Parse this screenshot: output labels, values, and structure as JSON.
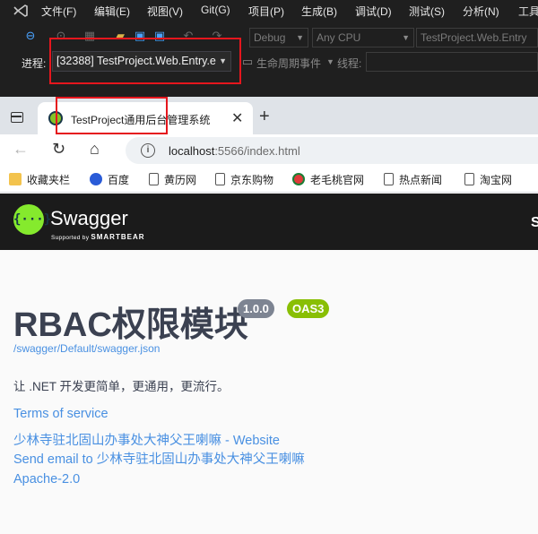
{
  "vs": {
    "menu": [
      "文件(F)",
      "编辑(E)",
      "视图(V)",
      "Git(G)",
      "项目(P)",
      "生成(B)",
      "调试(D)",
      "测试(S)",
      "分析(N)",
      "工具"
    ],
    "config": "Debug",
    "platform": "Any CPU",
    "startup_project": "TestProject.Web.Entry",
    "process_label": "进程:",
    "process_value": "[32388] TestProject.Web.Entry.e",
    "lifecycle_label": "生命周期事件",
    "thread_label": "线程:"
  },
  "browser": {
    "tab_title": "TestProject通用后台管理系统",
    "url_host": "localhost",
    "url_rest": ":5566/index.html",
    "bookmarks": [
      "收藏夹栏",
      "百度",
      "黄历网",
      "京东购物",
      "老毛桃官网",
      "热点新闻",
      "淘宝网"
    ]
  },
  "swagger": {
    "brand": "Swagger",
    "sub_prefix": "Supported by",
    "sub_brand": "SMARTBEAR",
    "logo_glyph": "{···}",
    "edge_char": "S",
    "title": "RBAC权限模块",
    "version": "1.0.0",
    "oas": "OAS3",
    "spec_url": "/swagger/Default/swagger.json",
    "description": "让 .NET 开发更简单，更通用，更流行。",
    "terms": "Terms of service",
    "website": "少林寺驻北固山办事处大神父王喇嘛 - Website",
    "email": "Send email to 少林寺驻北固山办事处大神父王喇嘛",
    "license": "Apache-2.0"
  },
  "colors": {
    "highlight": "#e5161d",
    "swagger_green": "#85ea2d",
    "link": "#4990e2",
    "title": "#3b4151",
    "oas_badge": "#89bf04",
    "version_badge": "#7d8492"
  }
}
